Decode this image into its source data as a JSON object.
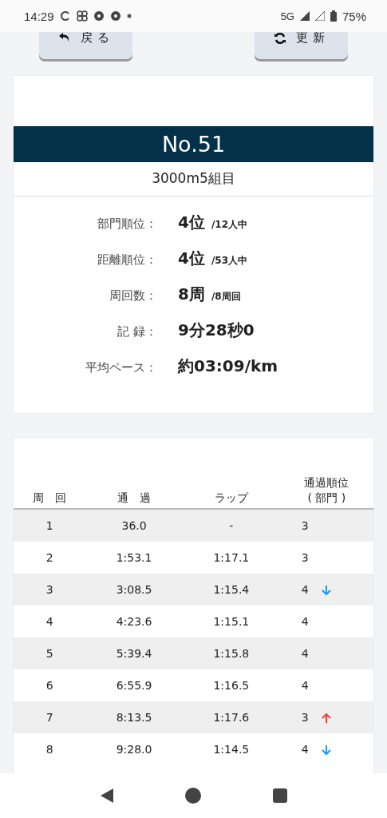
{
  "status_bar": {
    "time": "14:29",
    "network": "5G",
    "battery": "75%"
  },
  "buttons": [
    {
      "kind": "back",
      "label": "戻る"
    },
    {
      "kind": "refresh",
      "label": "更新"
    }
  ],
  "result": {
    "bib": "No.51",
    "race": "3000m5組目",
    "stats": [
      {
        "label": "部門順位：",
        "value": "4位",
        "note": "/12人中"
      },
      {
        "label": "距離順位：",
        "value": "4位",
        "note": "/53人中"
      },
      {
        "label": "周回数：",
        "value": "8周",
        "note": "/8周回"
      },
      {
        "label": "記 録：",
        "value": "9分28秒0"
      },
      {
        "label": "平均ペース：",
        "value": "約03:09/km"
      }
    ]
  },
  "laps": {
    "columns": [
      "周　回",
      "通　過",
      "ラップ",
      "通過順位\n( 部門 )"
    ],
    "rows": [
      {
        "lap": "1",
        "split": "36.0",
        "lap_time": "-",
        "rank": "3",
        "rank_up": false,
        "rank_down": false
      },
      {
        "lap": "2",
        "split": "1:53.1",
        "lap_time": "1:17.1",
        "rank": "3",
        "rank_up": false,
        "rank_down": false
      },
      {
        "lap": "3",
        "split": "3:08.5",
        "lap_time": "1:15.4",
        "rank": "4",
        "rank_up": false,
        "rank_down": true
      },
      {
        "lap": "4",
        "split": "4:23.6",
        "lap_time": "1:15.1",
        "rank": "4",
        "rank_up": false,
        "rank_down": false
      },
      {
        "lap": "5",
        "split": "5:39.4",
        "lap_time": "1:15.8",
        "rank": "4",
        "rank_up": false,
        "rank_down": false
      },
      {
        "lap": "6",
        "split": "6:55.9",
        "lap_time": "1:16.5",
        "rank": "4",
        "rank_up": false,
        "rank_down": false
      },
      {
        "lap": "7",
        "split": "8:13.5",
        "lap_time": "1:17.6",
        "rank": "3",
        "rank_up": true,
        "rank_down": false
      },
      {
        "lap": "8",
        "split": "9:28.0",
        "lap_time": "1:14.5",
        "rank": "4",
        "rank_up": false,
        "rank_down": true
      }
    ]
  }
}
